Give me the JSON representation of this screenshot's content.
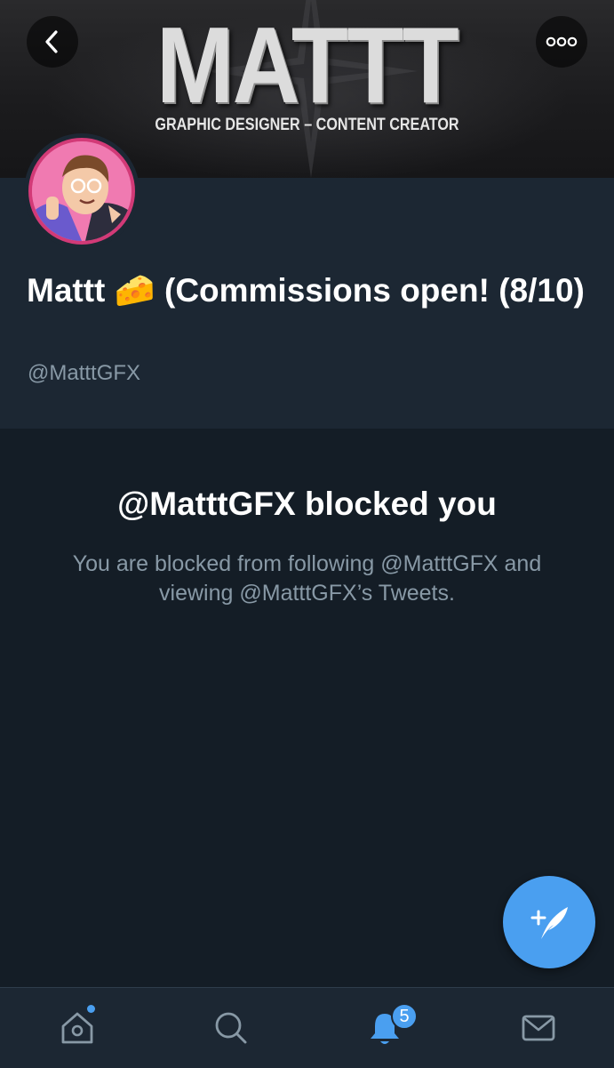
{
  "banner": {
    "logo_text": "MATTT",
    "subtitle": "GRAPHIC DESIGNER – CONTENT CREATOR"
  },
  "profile": {
    "display_name": "Mattt 🧀 (Commissions open! (8/10)",
    "handle": "@MatttGFX"
  },
  "blocked": {
    "title": "@MatttGFX blocked you",
    "description": "You are blocked from following @MatttGFX and viewing @MatttGFX’s Tweets."
  },
  "tabbar": {
    "notifications_count": "5",
    "items": [
      "home-icon",
      "search-icon",
      "notifications-icon",
      "messages-icon"
    ]
  },
  "icons": {
    "back": "chevron-left-icon",
    "more": "more-dots-icon",
    "compose": "compose-tweet-icon"
  },
  "colors": {
    "accent": "#4a9ff0",
    "background": "#141d26",
    "surface": "#1c2733",
    "secondary_text": "#8899a6"
  }
}
